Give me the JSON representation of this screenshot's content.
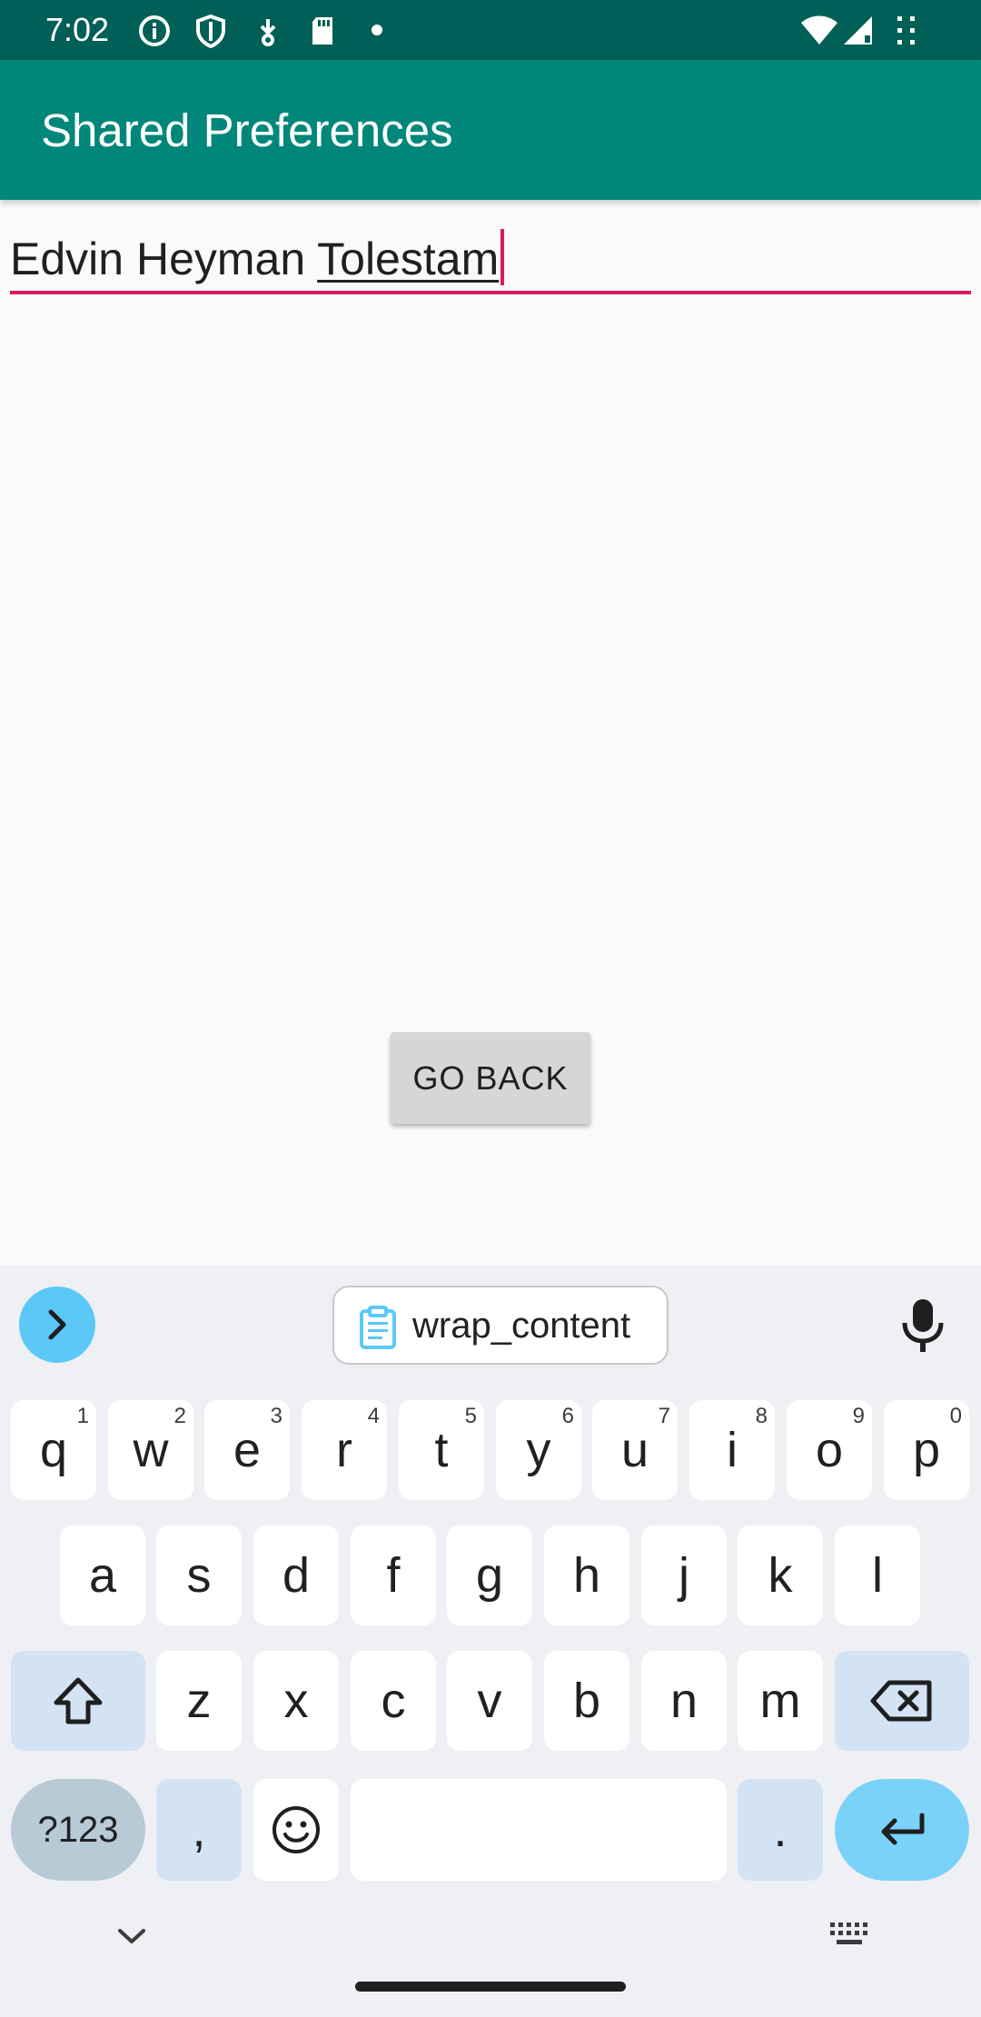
{
  "status_bar": {
    "time": "7:02",
    "icons": [
      "info-icon",
      "shield-icon",
      "download-icon",
      "sd-card-icon",
      "dot-icon",
      "wifi-icon",
      "signal-icon",
      "more-icon"
    ]
  },
  "app_bar": {
    "title": "Shared Preferences"
  },
  "edit_field": {
    "text_prefix": "Edvin Heyman ",
    "text_composing": "Tolestam",
    "accent_color": "#d81b60"
  },
  "go_back_button": {
    "label": "GO BACK"
  },
  "keyboard": {
    "clipboard_suggestion": "wrap_content",
    "row1": [
      {
        "label": "q",
        "hint": "1"
      },
      {
        "label": "w",
        "hint": "2"
      },
      {
        "label": "e",
        "hint": "3"
      },
      {
        "label": "r",
        "hint": "4"
      },
      {
        "label": "t",
        "hint": "5"
      },
      {
        "label": "y",
        "hint": "6"
      },
      {
        "label": "u",
        "hint": "7"
      },
      {
        "label": "i",
        "hint": "8"
      },
      {
        "label": "o",
        "hint": "9"
      },
      {
        "label": "p",
        "hint": "0"
      }
    ],
    "row2": [
      "a",
      "s",
      "d",
      "f",
      "g",
      "h",
      "j",
      "k",
      "l"
    ],
    "row3": [
      "z",
      "x",
      "c",
      "v",
      "b",
      "n",
      "m"
    ],
    "symbols_label": "?123",
    "comma_label": ",",
    "period_label": ".",
    "icons": {
      "shift": "shift-icon",
      "backspace": "backspace-icon",
      "emoji": "emoji-icon",
      "enter": "enter-icon",
      "mic": "mic-icon",
      "expand": "chevron-right-icon",
      "clipboard": "clipboard-icon"
    }
  },
  "nav_bar": {
    "icons": [
      "chevron-down-icon",
      "keyboard-icon"
    ]
  },
  "colors": {
    "status_bar": "#005f56",
    "app_bar": "#00877a",
    "accent": "#d81b60",
    "keyboard_bg": "#eff0f4",
    "enter_key": "#7bd2f8"
  }
}
